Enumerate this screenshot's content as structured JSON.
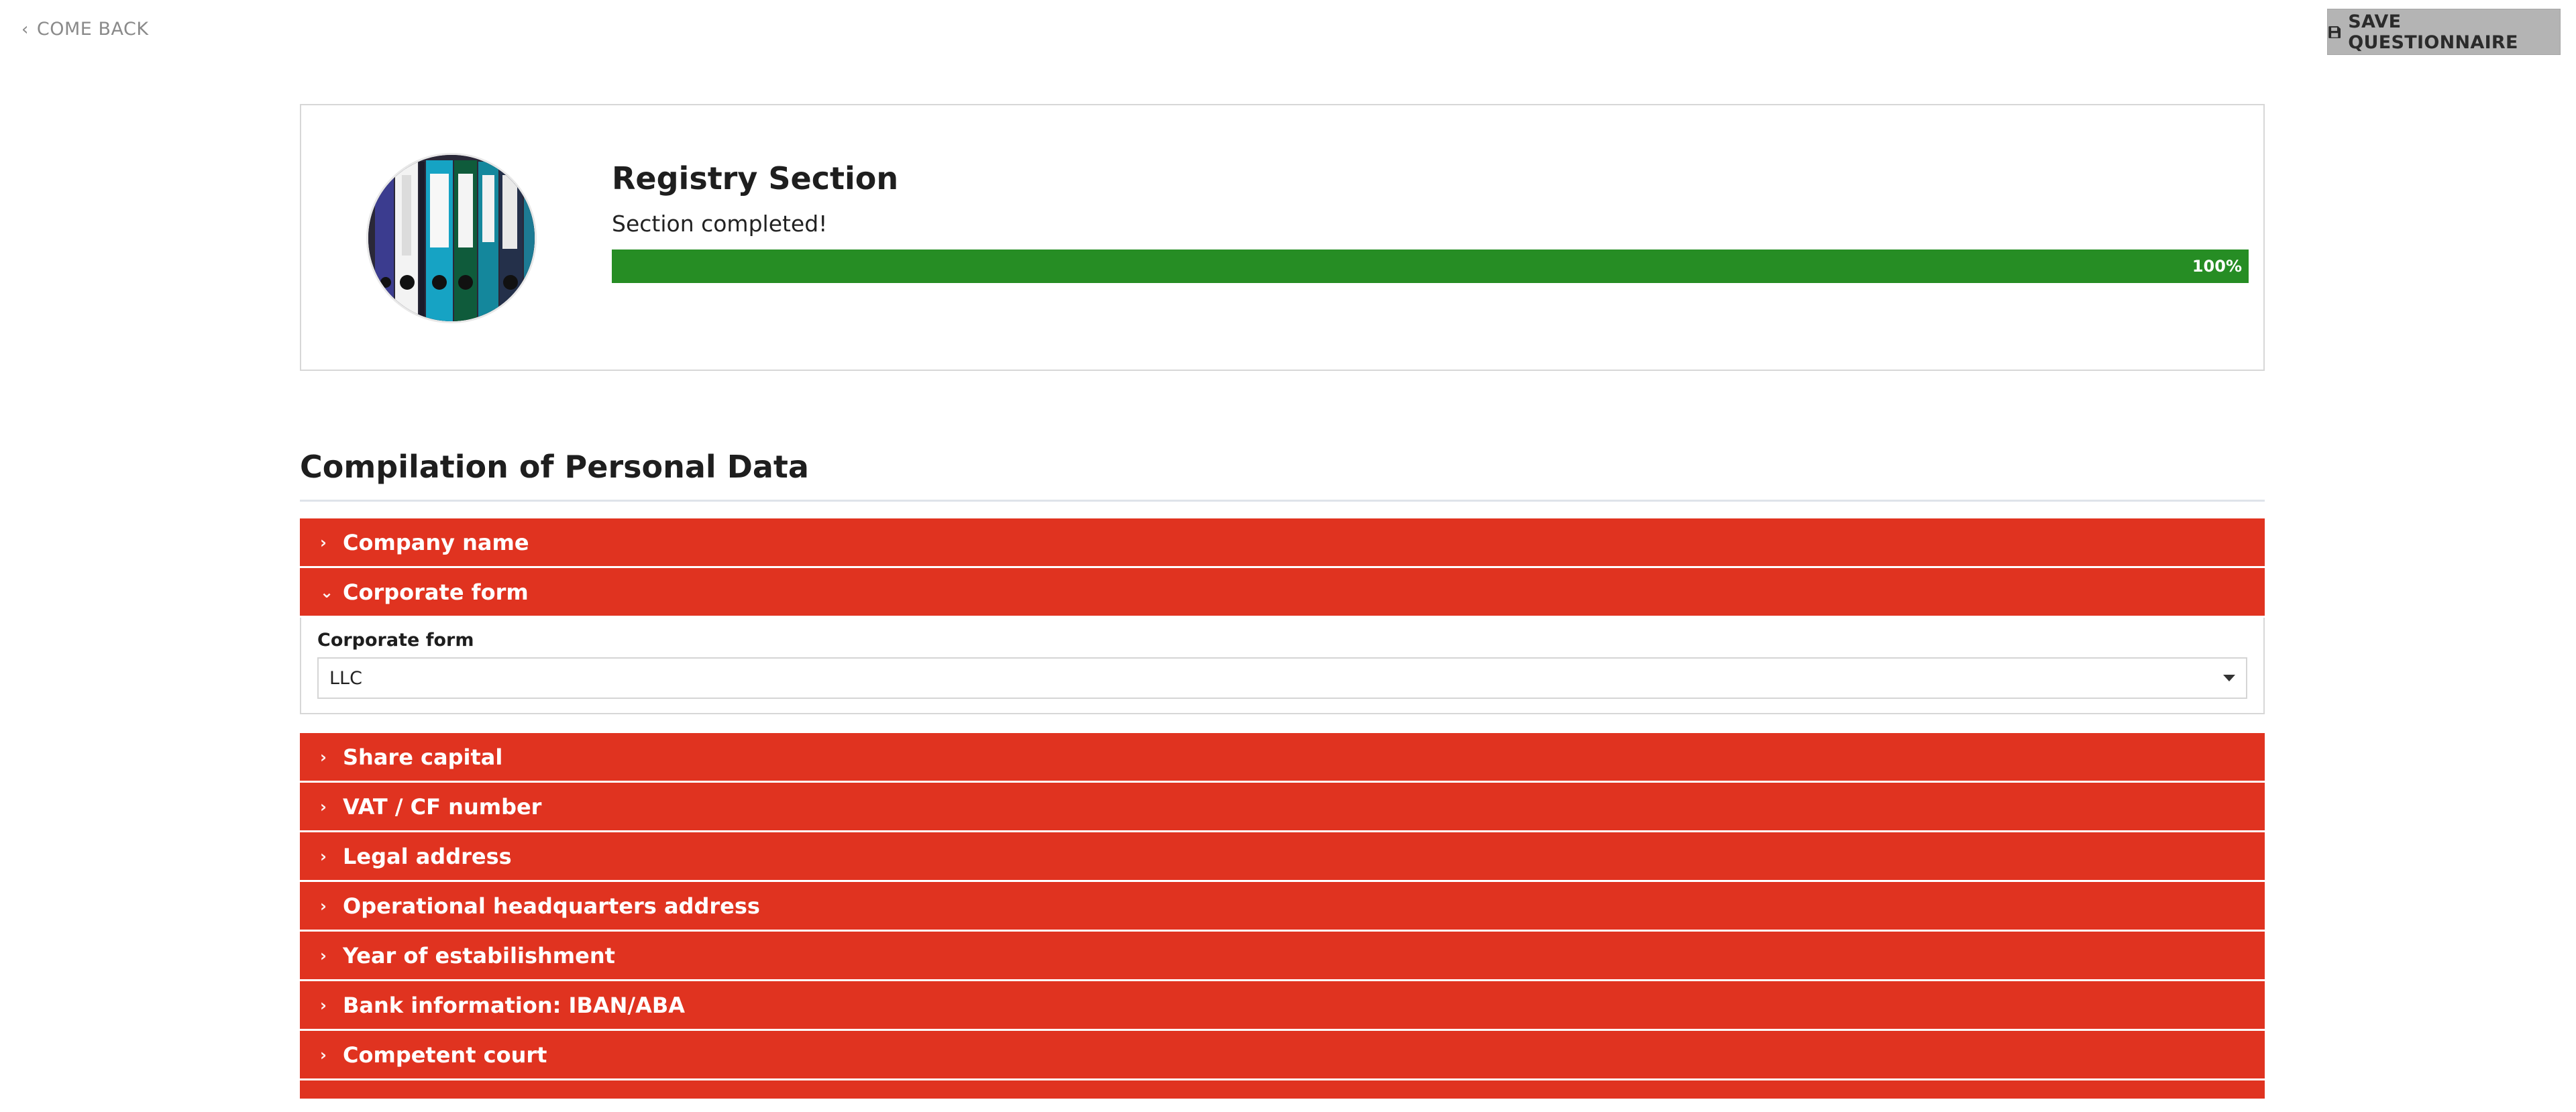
{
  "topbar": {
    "back_label": "COME BACK",
    "save_label": "SAVE QUESTIONNAIRE"
  },
  "section": {
    "title": "Registry Section",
    "status": "Section completed!",
    "progress_value": 100,
    "progress_label": "100%",
    "avatar_icon": "binders-photo-icon"
  },
  "compilation": {
    "title": "Compilation of Personal Data",
    "items": [
      {
        "label": "Company name",
        "expanded": false
      },
      {
        "label": "Corporate form",
        "expanded": true,
        "field_label": "Corporate form",
        "field_value": "LLC"
      },
      {
        "label": "Share capital",
        "expanded": false
      },
      {
        "label": "VAT / CF number",
        "expanded": false
      },
      {
        "label": "Legal address",
        "expanded": false
      },
      {
        "label": "Operational headquarters address",
        "expanded": false
      },
      {
        "label": "Year of estabilishment",
        "expanded": false
      },
      {
        "label": "Bank information: IBAN/ABA",
        "expanded": false
      },
      {
        "label": "Competent court",
        "expanded": false
      }
    ]
  },
  "colors": {
    "accordion_red": "#e03320",
    "progress_green": "#268d24",
    "save_button_gray": "#b4b4b4"
  }
}
